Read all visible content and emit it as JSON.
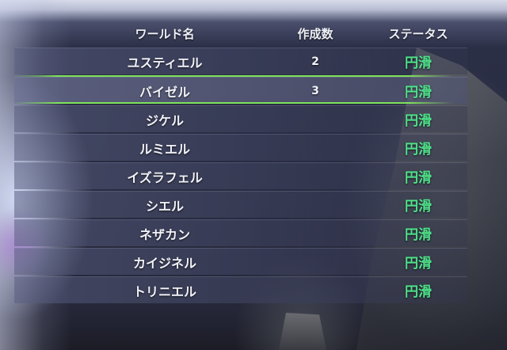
{
  "table": {
    "headers": {
      "name": "ワールド名",
      "count": "作成数",
      "status": "ステータス"
    },
    "rows": [
      {
        "name": "ユスティエル",
        "count": "2",
        "status": "円滑"
      },
      {
        "name": "バイゼル",
        "count": "3",
        "status": "円滑"
      },
      {
        "name": "ジケル",
        "count": "",
        "status": "円滑"
      },
      {
        "name": "ルミエル",
        "count": "",
        "status": "円滑"
      },
      {
        "name": "イズラフェル",
        "count": "",
        "status": "円滑"
      },
      {
        "name": "シエル",
        "count": "",
        "status": "円滑"
      },
      {
        "name": "ネザカン",
        "count": "",
        "status": "円滑"
      },
      {
        "name": "カイジネル",
        "count": "",
        "status": "円滑"
      },
      {
        "name": "トリニエル",
        "count": "",
        "status": "円滑"
      }
    ],
    "selected_row": 1
  },
  "colors": {
    "status_ok": "#4fe08a",
    "selection": "#7ee25a"
  }
}
